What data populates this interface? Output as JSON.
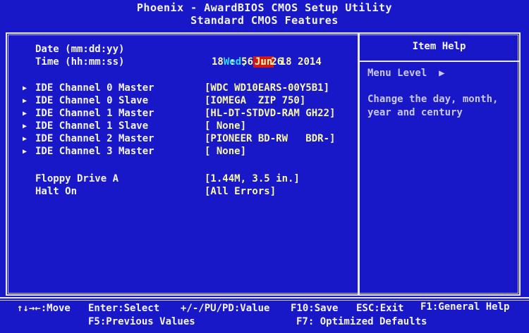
{
  "header": {
    "title": "Phoenix - AwardBIOS CMOS Setup Utility",
    "subtitle": "Standard CMOS Features"
  },
  "main": {
    "date": {
      "label": "Date (mm:dd:yy)",
      "weekday": "Wed,",
      "month": "Jun",
      "rest": "18 2014"
    },
    "time": {
      "label": "Time (hh:mm:ss)",
      "value": "18 : 56 : 26"
    },
    "items": [
      {
        "label": "IDE Channel 0 Master",
        "value": "[WDC WD10EARS-00Y5B1]"
      },
      {
        "label": "IDE Channel 0 Slave",
        "value": "[IOMEGA  ZIP 750]"
      },
      {
        "label": "IDE Channel 1 Master",
        "value": "[HL-DT-STDVD-RAM GH22]"
      },
      {
        "label": "IDE Channel 1 Slave",
        "value": "[ None]"
      },
      {
        "label": "IDE Channel 2 Master",
        "value": "[PIONEER BD-RW   BDR-]"
      },
      {
        "label": "IDE Channel 3 Master",
        "value": "[ None]"
      }
    ],
    "floppy": {
      "label": "Floppy Drive A",
      "value": "[1.44M, 3.5 in.]"
    },
    "halt": {
      "label": "Halt On",
      "value": "[All Errors]"
    },
    "submenu_arrow": "▶"
  },
  "help": {
    "title": "Item Help",
    "menu_level": "Menu Level  ▶",
    "line1": "Change the day, month,",
    "line2": "year and century"
  },
  "footer": {
    "move": "↑↓→←:Move",
    "select": "Enter:Select",
    "value": "+/-/PU/PD:Value",
    "save": "F10:Save",
    "exit": "ESC:Exit",
    "general_help": "F1:General Help",
    "previous_values": "F5:Previous Values",
    "optimized_defaults": "F7: Optimized Defaults"
  }
}
